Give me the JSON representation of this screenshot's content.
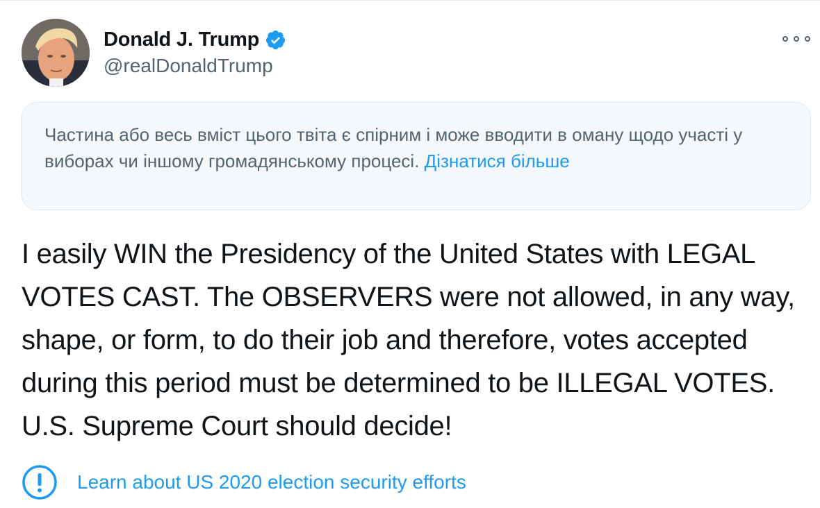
{
  "author": {
    "display_name": "Donald J. Trump",
    "handle": "@realDonaldTrump",
    "verified_icon": "verified-badge-icon"
  },
  "notice": {
    "text": "Частина або весь вміст цього твіта є спірним і може вводити в оману щодо участі у виборах чи іншому громадянському процесі. ",
    "link": "Дізнатися більше"
  },
  "tweet": {
    "text": "I easily WIN the Presidency of the United States with LEGAL VOTES CAST. The OBSERVERS were not allowed, in any way, shape, or form, to do their job and therefore, votes accepted during this period must be determined to be ILLEGAL VOTES. U.S. Supreme Court should decide!"
  },
  "election_label": {
    "icon": "exclamation-circle-icon",
    "text": "Learn about US 2020 election security efforts"
  },
  "colors": {
    "accent": "#1d9bf0",
    "secondary_text": "#536471",
    "notice_bg": "#f5f8fa"
  }
}
